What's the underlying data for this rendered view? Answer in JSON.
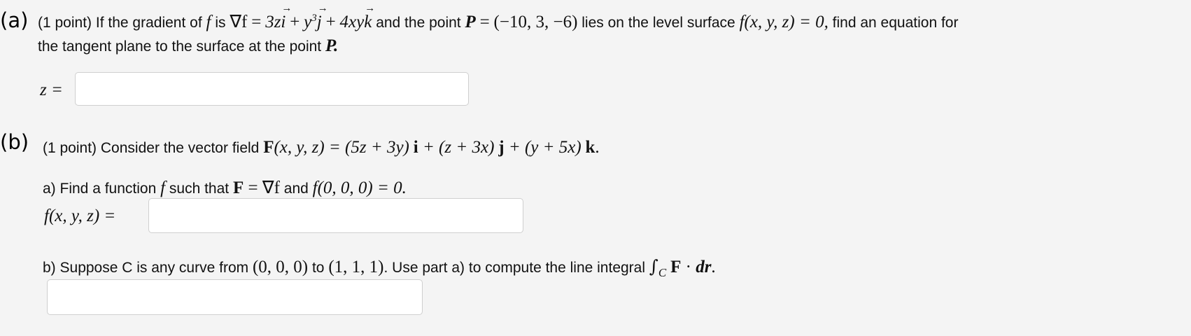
{
  "part_a": {
    "label": "(a)",
    "points": "(1 point)",
    "t_if": "If the gradient of",
    "f": "f",
    "t_is": "is",
    "grad_f": "∇f",
    "eq": "=",
    "term1": "3z",
    "i": "i",
    "plus": "+",
    "y": "y",
    "cube": "3",
    "j": "j",
    "term3": "4xy",
    "k": "k",
    "t_and_point": "and the point",
    "P": "P",
    "P_value": "(−10, 3, −6)",
    "t_lies": "lies on the level surface",
    "level_surface": "f(x, y, z) = 0,",
    "t_find": "find an equation for",
    "line2_text": "the tangent plane to the surface at the point",
    "P_end": "P.",
    "answer_prefix": "z =",
    "answer_value": ""
  },
  "part_b": {
    "label": "(b)",
    "points": "(1 point)",
    "t_consider": "Consider the vector field",
    "F": "F",
    "F_args": "(x, y, z) = (5z + 3y)",
    "i": "i",
    "mid1": " + (z + 3x)",
    "j": "j",
    "mid2": " + (y + 5x)",
    "k": "k",
    "period": ".",
    "qa_text": "a) Find a function",
    "qa_f": "f",
    "qa_such": "such that",
    "qa_F": "F",
    "qa_grad": " = ∇f",
    "qa_and": "and",
    "qa_cond": "f(0, 0, 0) = 0.",
    "qa_prefix": "f(x, y, z) =",
    "qa_answer": "",
    "qb_text": "b) Suppose C is any curve from",
    "qb_from": "(0, 0, 0)",
    "qb_to_word": "to",
    "qb_to": "(1, 1, 1)",
    "qb_rest": ". Use part a) to compute the line integral",
    "qb_int": "∫",
    "qb_C": "C",
    "qb_F": "F",
    "qb_dot": " · ",
    "qb_dr": "dr",
    "qb_period": ".",
    "qb_answer": ""
  }
}
